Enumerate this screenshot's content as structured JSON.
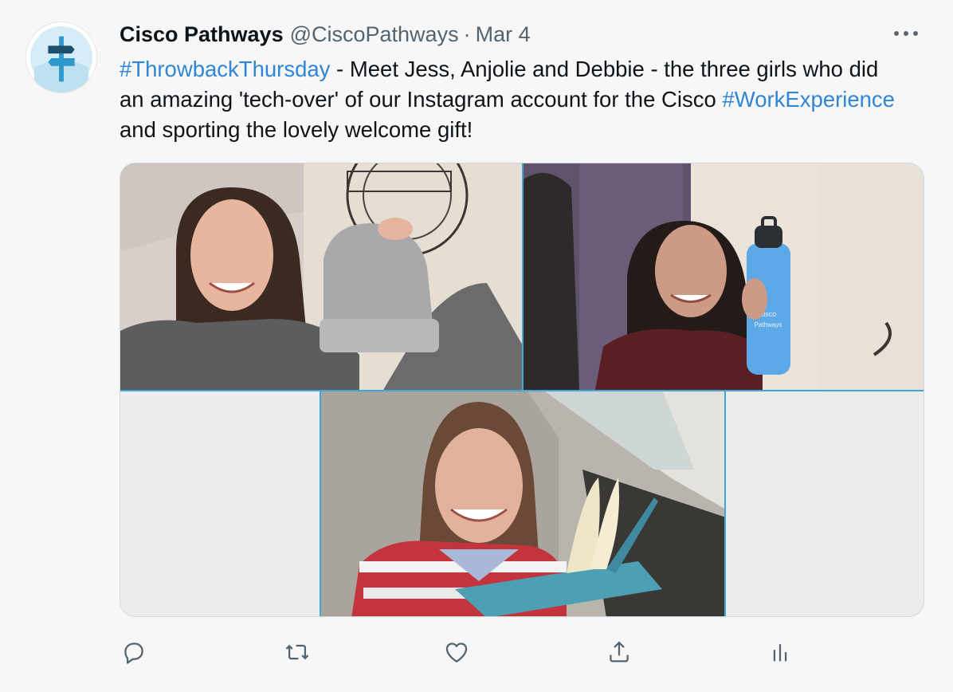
{
  "author": {
    "name": "Cisco Pathways",
    "handle": "@CiscoPathways",
    "separator": "·",
    "date": "Mar 4"
  },
  "tweet": {
    "hashtag1": "#ThrowbackThursday",
    "text1": " - Meet Jess, Anjolie and Debbie - the three girls who did an amazing 'tech-over' of our Instagram account for the Cisco ",
    "hashtag2": "#WorkExperience",
    "text2": " and sporting the lovely welcome gift!"
  },
  "media": {
    "bottle_logo_text": "cisco",
    "bottle_label_text": "Pathways"
  },
  "icons": {
    "more": "more-horizontal-icon",
    "reply": "reply-icon",
    "retweet": "retweet-icon",
    "like": "heart-icon",
    "share": "share-icon",
    "analytics": "analytics-icon"
  },
  "colors": {
    "link": "#2f86d6",
    "text": "#0f1419",
    "muted": "#536471",
    "frame": "#3ea6d8",
    "background": "#f7f7f7"
  }
}
